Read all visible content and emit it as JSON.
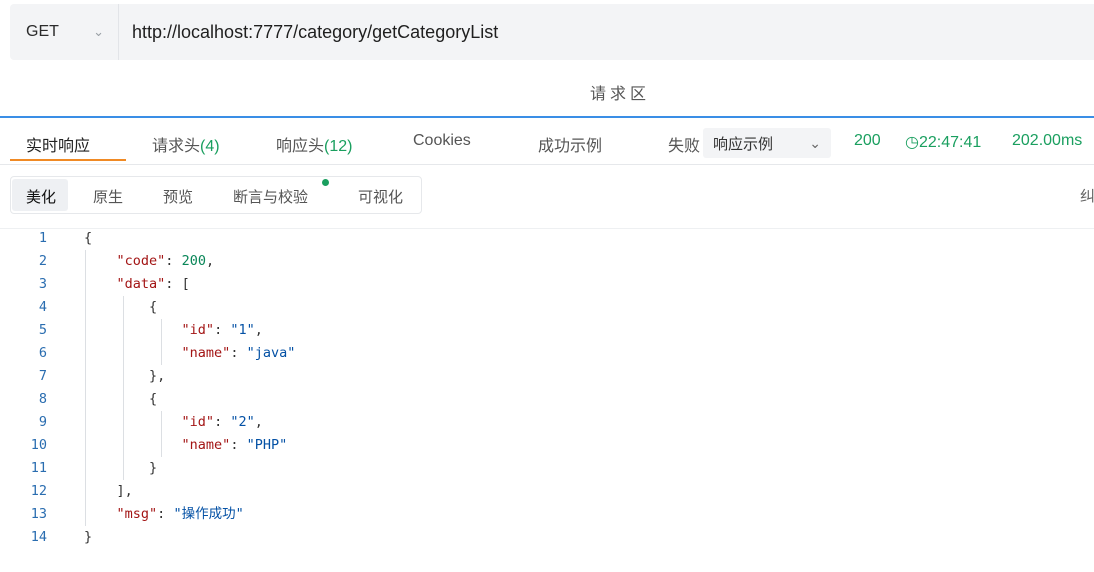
{
  "request": {
    "method": "GET",
    "url": "http://localhost:7777/category/getCategoryList",
    "area_label": "请求区"
  },
  "tabs": [
    {
      "label": "实时响应",
      "count": ""
    },
    {
      "label": "请求头",
      "count": "(4)"
    },
    {
      "label": "响应头",
      "count": "(12)"
    },
    {
      "label": "Cookies",
      "count": ""
    },
    {
      "label": "成功示例",
      "count": ""
    },
    {
      "label": "失败",
      "count": ""
    }
  ],
  "response_select": {
    "value": "响应示例"
  },
  "status": {
    "code": "200",
    "time": "22:47:41",
    "duration": "202.00ms"
  },
  "format_tabs": [
    "美化",
    "原生",
    "预览",
    "断言与校验",
    "可视化"
  ],
  "right_glyph": "纠",
  "code_lines": [
    "{",
    "    \"code\": 200,",
    "    \"data\": [",
    "        {",
    "            \"id\": \"1\",",
    "            \"name\": \"java\"",
    "        },",
    "        {",
    "            \"id\": \"2\",",
    "            \"name\": \"PHP\"",
    "        }",
    "    ],",
    "    \"msg\": \"操作成功\"",
    "}"
  ],
  "colors": {
    "accent": "#3a8ee6",
    "active_tab": "#f08a24",
    "success": "#1a9f5f"
  }
}
